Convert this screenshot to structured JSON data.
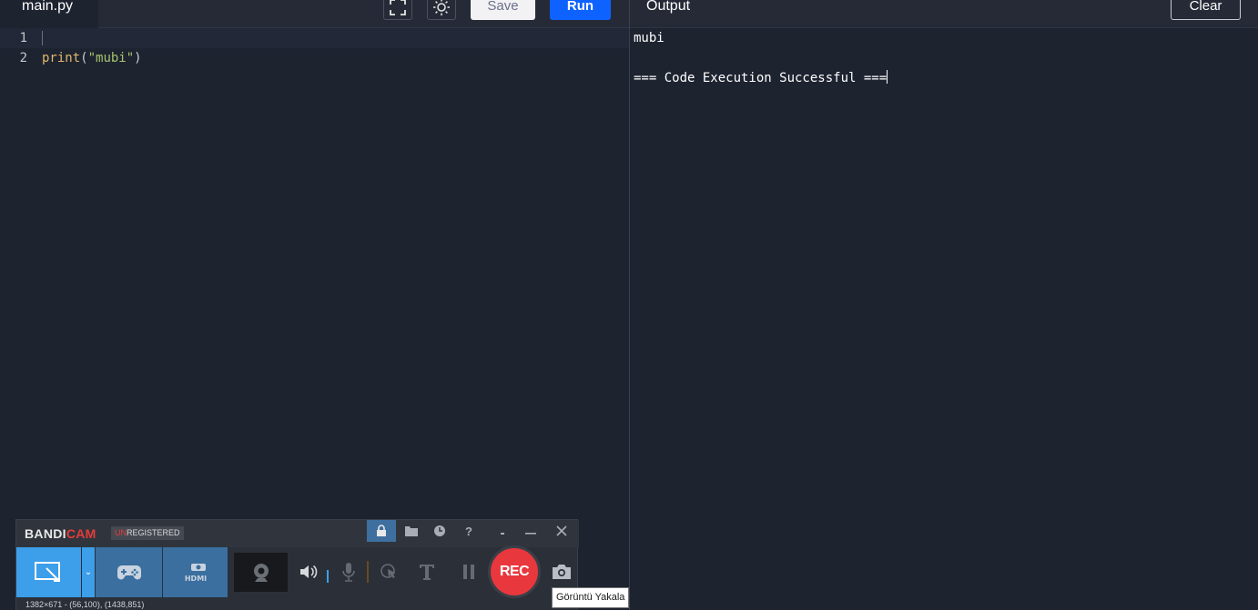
{
  "editor": {
    "tab_label": "main.py",
    "fullscreen_icon": "fullscreen-icon",
    "theme_icon": "sun-icon",
    "save_label": "Save",
    "run_label": "Run",
    "lines": [
      {
        "number": "1",
        "code": ""
      },
      {
        "number": "2",
        "fn": "print",
        "open": "(",
        "str": "\"mubi\"",
        "close": ")"
      }
    ],
    "colors": {
      "background": "#1e2330",
      "run_button": "#0e62ff",
      "function": "#e2b86b",
      "string": "#a5c46c"
    }
  },
  "output": {
    "title": "Output",
    "clear_label": "Clear",
    "lines": [
      "mubi",
      "",
      "=== Code Execution Successful ==="
    ]
  },
  "bandicam": {
    "logo_bandi": "BANDI",
    "logo_cam": "CAM",
    "badge_un": "UN",
    "badge_rest": "REGISTERED",
    "rec_label": "REC",
    "status_text": "1382×671 - (56,100), (1438,851)",
    "icons": [
      "lock-icon",
      "folder-icon",
      "clock-icon",
      "help-icon",
      "minimize-icon",
      "close-icon",
      "screen-mode-icon",
      "gamepad-icon",
      "hdmi-icon",
      "webcam-icon",
      "speaker-icon",
      "microphone-icon",
      "cursor-icon",
      "text-icon",
      "pause-icon",
      "camera-icon"
    ],
    "colors": {
      "rec": "#e8373d",
      "screen_mode": "#3d9ee9",
      "brand_cam": "#e53b3b"
    },
    "tooltip": "Görüntü Yakala"
  }
}
